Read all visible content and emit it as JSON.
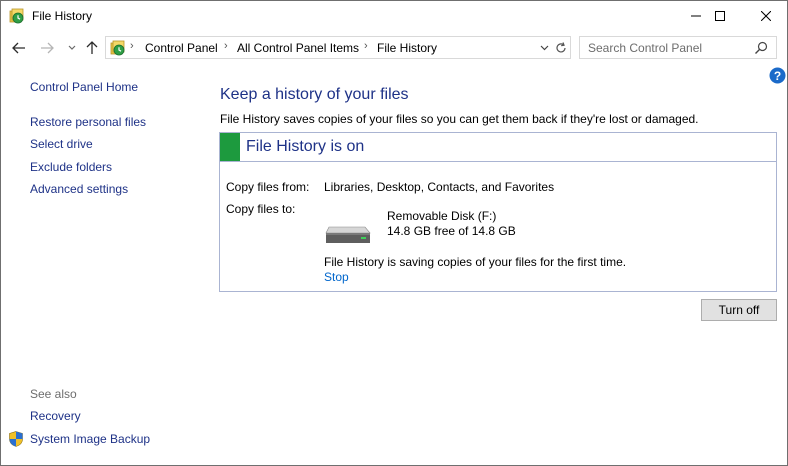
{
  "window": {
    "title": "File History",
    "controls": {
      "minimize": "minimize-icon",
      "maximize": "maximize-icon",
      "close": "close-icon"
    }
  },
  "navigation": {
    "back": "arrow-left-icon",
    "forward": "arrow-right-icon",
    "recent": "chevron-down-icon",
    "up": "arrow-up-icon",
    "breadcrumb": [
      "Control Panel",
      "All Control Panel Items",
      "File History"
    ],
    "search_placeholder": "Search Control Panel"
  },
  "left_pane": {
    "home_link": "Control Panel Home",
    "links": [
      "Restore personal files",
      "Select drive",
      "Exclude folders",
      "Advanced settings"
    ],
    "see_also_label": "See also",
    "see_also_links": [
      "Recovery",
      "System Image Backup"
    ]
  },
  "content": {
    "heading": "Keep a history of your files",
    "description": "File History saves copies of your files so you can get them back if they're lost or damaged.",
    "status": {
      "title": "File History is on",
      "color": "#1d9a3e"
    },
    "copy_from_label": "Copy files from:",
    "copy_from_value": "Libraries, Desktop, Contacts, and Favorites",
    "copy_to_label": "Copy files to:",
    "drive": {
      "name": "Removable Disk (F:)",
      "space": "14.8 GB free of 14.8 GB"
    },
    "progress_message": "File History is saving copies of your files for the first time.",
    "stop_link": "Stop",
    "turn_off_button": "Turn off"
  },
  "colors": {
    "link": "#1e3287",
    "stop_link": "#0066cc",
    "panel_border": "#aab4d2"
  }
}
